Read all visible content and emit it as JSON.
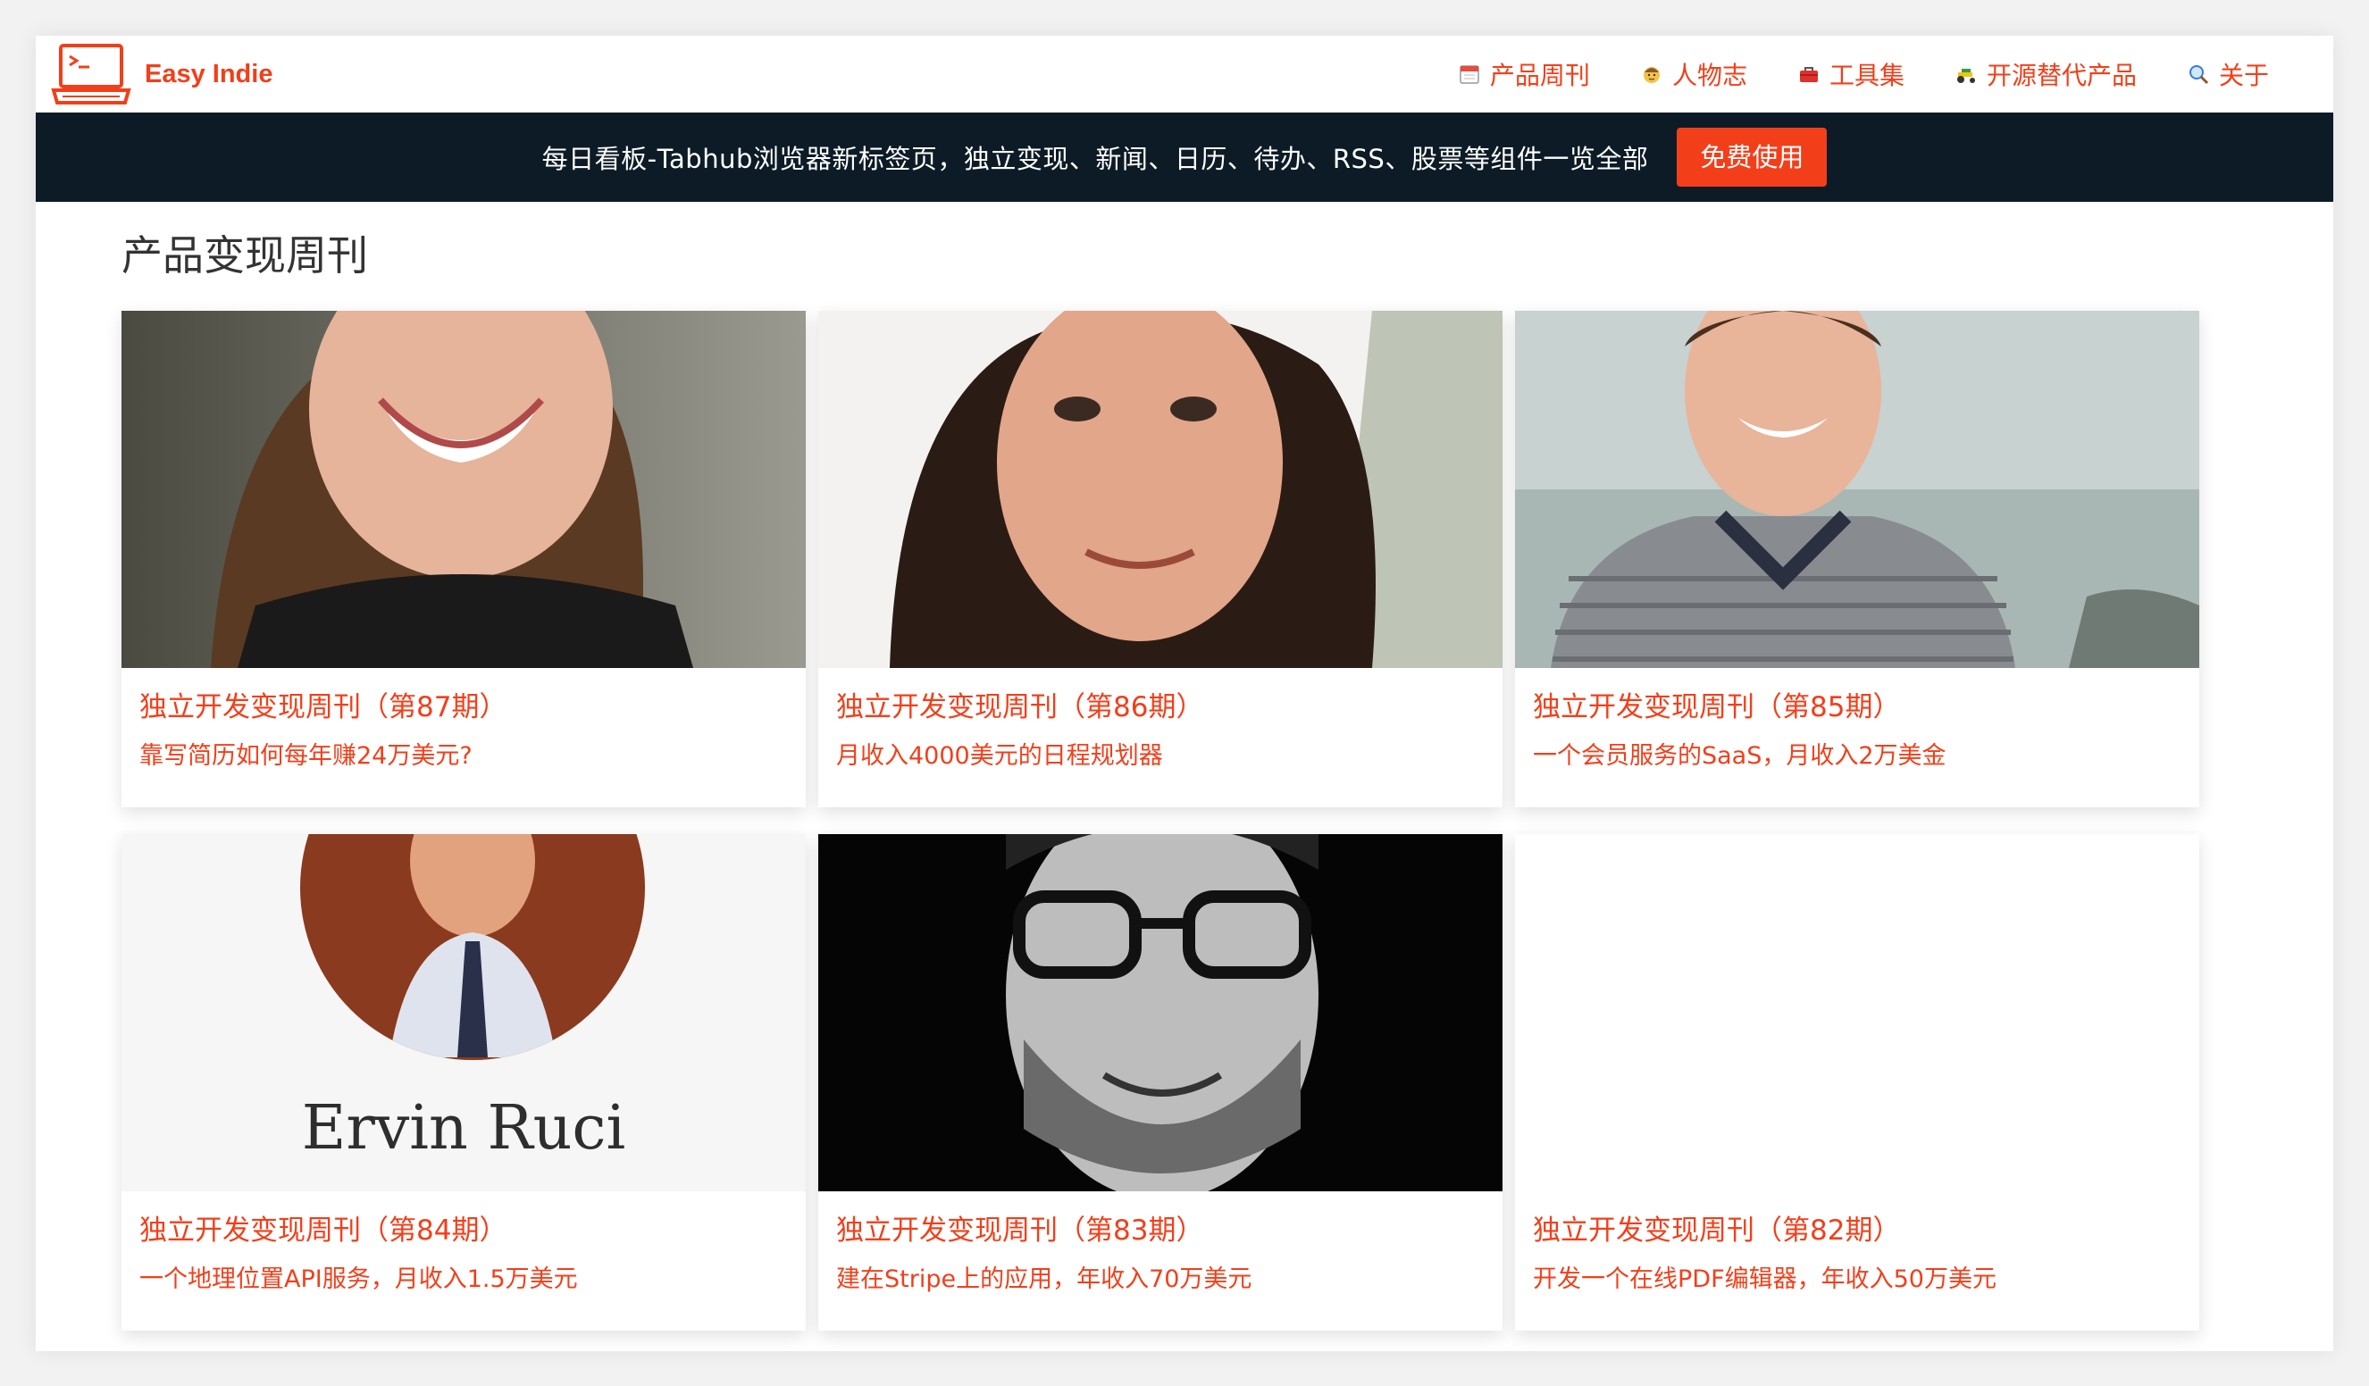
{
  "header": {
    "brand": "Easy Indie",
    "nav": [
      {
        "label": "产品周刊",
        "icon": "calendar-icon"
      },
      {
        "label": "人物志",
        "icon": "person-icon"
      },
      {
        "label": "工具集",
        "icon": "toolbox-icon"
      },
      {
        "label": "开源替代产品",
        "icon": "tractor-icon"
      },
      {
        "label": "关于",
        "icon": "magnifier-icon"
      }
    ]
  },
  "banner": {
    "text": "每日看板-Tabhub浏览器新标签页，独立变现、新闻、日历、待办、RSS、股票等组件一览全部",
    "button": "免费使用"
  },
  "section": {
    "title": "产品变现周刊"
  },
  "cards": [
    {
      "title": "独立开发变现周刊（第87期）",
      "subtitle": "靠写简历如何每年赚24万美元?"
    },
    {
      "title": "独立开发变现周刊（第86期）",
      "subtitle": "月收入4000美元的日程规划器"
    },
    {
      "title": "独立开发变现周刊（第85期）",
      "subtitle": "一个会员服务的SaaS，月收入2万美金"
    },
    {
      "title": "独立开发变现周刊（第84期）",
      "subtitle": "一个地理位置API服务，月收入1.5万美元",
      "image_text": "Ervin Ruci"
    },
    {
      "title": "独立开发变现周刊（第83期）",
      "subtitle": "建在Stripe上的应用，年收入70万美元"
    },
    {
      "title": "独立开发变现周刊（第82期）",
      "subtitle": "开发一个在线PDF编辑器，年收入50万美元"
    }
  ],
  "colors": {
    "accent": "#f23f1a",
    "banner_bg": "#0c1b26"
  }
}
